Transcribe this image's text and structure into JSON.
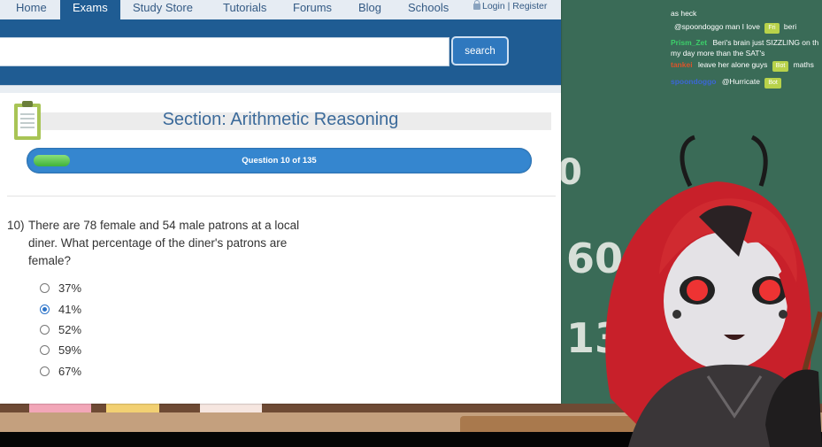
{
  "nav": {
    "items": [
      {
        "label": "Home"
      },
      {
        "label": "Exams"
      },
      {
        "label": "Study Store"
      },
      {
        "label": "Tutorials"
      },
      {
        "label": "Forums"
      },
      {
        "label": "Blog"
      },
      {
        "label": "Schools"
      }
    ],
    "active": "Exams",
    "login_label": "Login",
    "register_label": "Register"
  },
  "search": {
    "value": "",
    "button_label": "search"
  },
  "section": {
    "title": "Section: Arithmetic Reasoning"
  },
  "progress": {
    "label": "Question 10 of 135",
    "current": 10,
    "total": 135
  },
  "question": {
    "number": "10)",
    "text": "There are 78 female and 54 male patrons at a local diner. What percentage of the diner's patrons are female?",
    "options": [
      {
        "label": "37%",
        "selected": false
      },
      {
        "label": "41%",
        "selected": true
      },
      {
        "label": "52%",
        "selected": false
      },
      {
        "label": "59%",
        "selected": false
      },
      {
        "label": "67%",
        "selected": false
      }
    ]
  },
  "chat": {
    "lines": [
      {
        "user": "",
        "text": "as heck",
        "user_color": "#ffffff"
      },
      {
        "user": "",
        "text": "@spoondoggo man I love",
        "badge": "Fri",
        "tail": "beri",
        "user_color": "#3cb045"
      },
      {
        "user": "Prism_Zet",
        "text": "Beri's brain just SIZZLING on th",
        "user_color": "#3ccf6a"
      },
      {
        "user": "",
        "text": "my day more than the SAT's",
        "user_color": "#ffffff"
      },
      {
        "user": "tankei",
        "text": "leave her alone guys",
        "badge": "Bot",
        "tail": "maths",
        "user_color": "#d9542b"
      },
      {
        "user": "spoondoggo",
        "text": "@Hurricate",
        "badge": "Bot",
        "tail": "",
        "user_color": "#3b66d6"
      }
    ]
  },
  "chalkboard": {
    "text1": "0",
    "text2": "600",
    "text3": "139"
  }
}
